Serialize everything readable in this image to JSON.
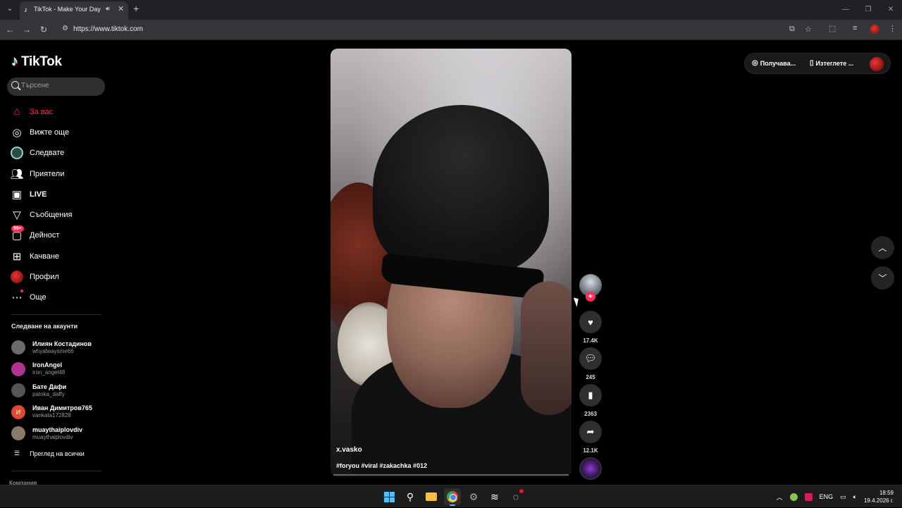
{
  "browser": {
    "tab_title": "TikTok - Make Your Day",
    "url": "https://www.tiktok.com"
  },
  "sidebar": {
    "brand": "TikTok",
    "search_placeholder": "Търсене",
    "nav": [
      {
        "label": "За вас",
        "icon": "home-icon",
        "active": true
      },
      {
        "label": "Вижте още",
        "icon": "compass-icon"
      },
      {
        "label": "Следвате",
        "icon": "following-icon"
      },
      {
        "label": "Приятели",
        "icon": "friends-icon"
      },
      {
        "label": "LIVE",
        "icon": "live-icon"
      },
      {
        "label": "Съобщения",
        "icon": "send-icon"
      },
      {
        "label": "Дейност",
        "icon": "activity-icon",
        "badge": "99+"
      },
      {
        "label": "Качване",
        "icon": "upload-icon"
      },
      {
        "label": "Профил",
        "icon": "profile-icon"
      },
      {
        "label": "Още",
        "icon": "more-icon"
      }
    ],
    "following_title": "Следване на акаунти",
    "accounts": [
      {
        "name": "Илиян Костадинов",
        "handle": "whyalwaysme66",
        "avatar_color": "#6b6b6b"
      },
      {
        "name": "IronAngel",
        "handle": "iron_angel48",
        "avatar_color": "#b0338f"
      },
      {
        "name": "Бате Дафи",
        "handle": "patoka_daffy",
        "avatar_color": "#555555"
      },
      {
        "name": "Иван Димитров765",
        "handle": "vankata172828",
        "avatar_color": "#e0482f",
        "initial": "И"
      },
      {
        "name": "muaythaiplovdiv",
        "handle": "muaythaiplovdiv",
        "avatar_color": "#8a7a6a"
      }
    ],
    "see_all": "Преглед на всички",
    "company": "Компания"
  },
  "video": {
    "author": "x.vasko",
    "caption": "#foryou #viral #zakachka #012",
    "likes": "17.4K",
    "comments": "245",
    "saves": "2363",
    "shares": "12.1K"
  },
  "topbar": {
    "get_coins": "Получава...",
    "download_app": "Изтеглете ..."
  },
  "taskbar": {
    "lang": "ENG",
    "time": "18:59",
    "date": "19.4.2026 г."
  }
}
